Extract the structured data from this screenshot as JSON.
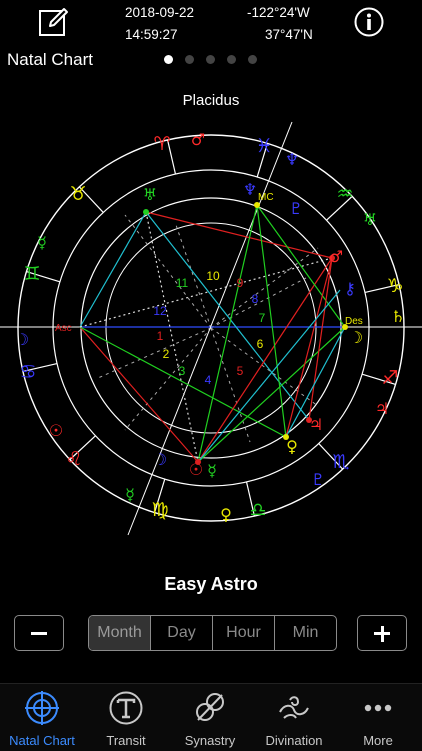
{
  "header": {
    "date": "2018-09-22",
    "time": "14:59:27",
    "longitude": "-122°24'W",
    "latitude": "37°47'N",
    "page_title": "Natal Chart",
    "page_count": 5,
    "current_page": 1
  },
  "wheel": {
    "house_system": "Placidus",
    "angles": [
      "Asc",
      "MC",
      "Des"
    ],
    "signs": [
      "♈",
      "♉",
      "♊",
      "♋",
      "♌",
      "♍",
      "♎",
      "♏",
      "♐",
      "♑",
      "♒",
      "♓"
    ],
    "house_numbers": [
      "1",
      "2",
      "3",
      "4",
      "5",
      "6",
      "7",
      "8",
      "9",
      "10",
      "11",
      "12"
    ],
    "planet_glyphs": [
      "☉",
      "☽",
      "☿",
      "♀",
      "♂",
      "♃",
      "♄",
      "♅",
      "♆",
      "♇",
      "☊",
      "⚷"
    ],
    "colors": {
      "fire": "#ff2a2a",
      "earth": "#e8e800",
      "air": "#22d022",
      "water": "#3a3aff",
      "axis": "#2f4dff"
    }
  },
  "app_name": "Easy Astro",
  "stepper": {
    "minus_label": "−",
    "plus_label": "+",
    "units": [
      "Month",
      "Day",
      "Hour",
      "Min"
    ],
    "selected": "Month"
  },
  "tabs": [
    {
      "label": "Natal Chart",
      "icon": "crosshair-icon",
      "active": true
    },
    {
      "label": "Transit",
      "icon": "transit-icon",
      "active": false
    },
    {
      "label": "Synastry",
      "icon": "synastry-icon",
      "active": false
    },
    {
      "label": "Divination",
      "icon": "divination-icon",
      "active": false
    },
    {
      "label": "More",
      "icon": "more-icon",
      "active": false
    }
  ]
}
